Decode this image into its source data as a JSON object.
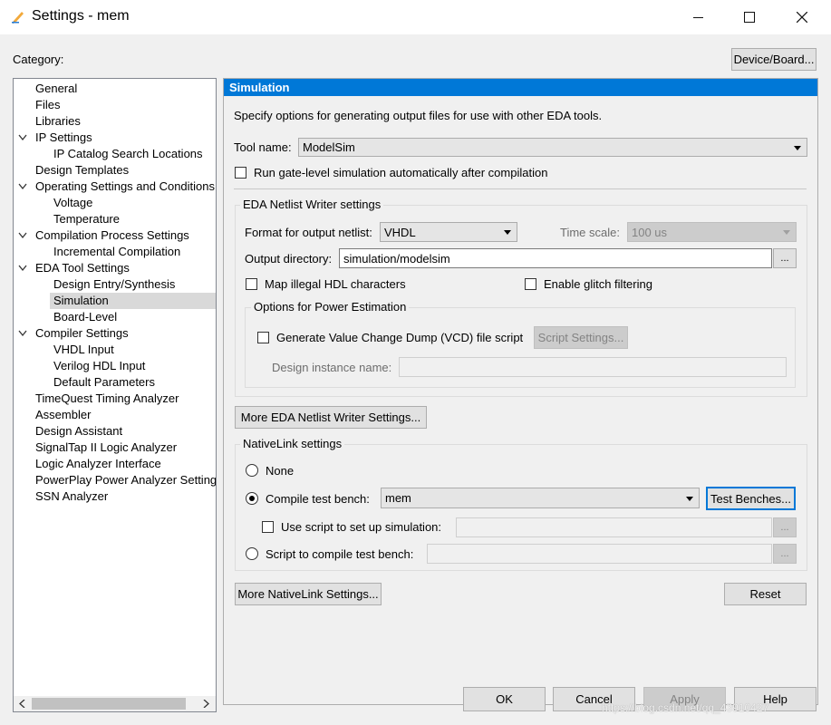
{
  "window": {
    "title": "Settings - mem",
    "minimize_glyph": "—",
    "maximize_glyph": "☐",
    "close_glyph": "✕"
  },
  "category_label": "Category:",
  "device_board_button": "Device/Board...",
  "tree": {
    "items": [
      {
        "label": "General",
        "level": 0,
        "expanded": null
      },
      {
        "label": "Files",
        "level": 0,
        "expanded": null
      },
      {
        "label": "Libraries",
        "level": 0,
        "expanded": null
      },
      {
        "label": "IP Settings",
        "level": 0,
        "expanded": true
      },
      {
        "label": "IP Catalog Search Locations",
        "level": 1,
        "expanded": null
      },
      {
        "label": "Design Templates",
        "level": 0,
        "expanded": null
      },
      {
        "label": "Operating Settings and Conditions",
        "level": 0,
        "expanded": true
      },
      {
        "label": "Voltage",
        "level": 1,
        "expanded": null
      },
      {
        "label": "Temperature",
        "level": 1,
        "expanded": null
      },
      {
        "label": "Compilation Process Settings",
        "level": 0,
        "expanded": true
      },
      {
        "label": "Incremental Compilation",
        "level": 1,
        "expanded": null
      },
      {
        "label": "EDA Tool Settings",
        "level": 0,
        "expanded": true
      },
      {
        "label": "Design Entry/Synthesis",
        "level": 1,
        "expanded": null
      },
      {
        "label": "Simulation",
        "level": 1,
        "expanded": null,
        "selected": true
      },
      {
        "label": "Board-Level",
        "level": 1,
        "expanded": null
      },
      {
        "label": "Compiler Settings",
        "level": 0,
        "expanded": true
      },
      {
        "label": "VHDL Input",
        "level": 1,
        "expanded": null
      },
      {
        "label": "Verilog HDL Input",
        "level": 1,
        "expanded": null
      },
      {
        "label": "Default Parameters",
        "level": 1,
        "expanded": null
      },
      {
        "label": "TimeQuest Timing Analyzer",
        "level": 0,
        "expanded": null
      },
      {
        "label": "Assembler",
        "level": 0,
        "expanded": null
      },
      {
        "label": "Design Assistant",
        "level": 0,
        "expanded": null
      },
      {
        "label": "SignalTap II Logic Analyzer",
        "level": 0,
        "expanded": null
      },
      {
        "label": "Logic Analyzer Interface",
        "level": 0,
        "expanded": null
      },
      {
        "label": "PowerPlay Power Analyzer Settings",
        "level": 0,
        "expanded": null
      },
      {
        "label": "SSN Analyzer",
        "level": 0,
        "expanded": null
      }
    ]
  },
  "panel": {
    "header": "Simulation",
    "description": "Specify options for generating output files for use with other EDA tools.",
    "tool_name_label": "Tool name:",
    "tool_name_value": "ModelSim",
    "run_gate_level_label": "Run gate-level simulation automatically after compilation",
    "run_gate_level_checked": false,
    "netlist": {
      "title": "EDA Netlist Writer settings",
      "format_label": "Format for output netlist:",
      "format_value": "VHDL",
      "time_scale_label": "Time scale:",
      "time_scale_value": "100 us",
      "output_dir_label": "Output directory:",
      "output_dir_value": "simulation/modelsim",
      "browse_label": "...",
      "map_illegal_label": "Map illegal HDL characters",
      "map_illegal_checked": false,
      "glitch_label": "Enable glitch filtering",
      "glitch_checked": false,
      "power": {
        "title": "Options for Power Estimation",
        "vcd_label": "Generate Value Change Dump (VCD) file script",
        "vcd_checked": false,
        "script_settings_button": "Script Settings...",
        "design_instance_label": "Design instance name:",
        "design_instance_value": ""
      }
    },
    "more_eda_button": "More EDA Netlist Writer Settings...",
    "nativelink": {
      "title": "NativeLink settings",
      "none_label": "None",
      "compile_tb_label": "Compile test bench:",
      "compile_tb_value": "mem",
      "test_benches_button": "Test Benches...",
      "use_script_label": "Use script to set up simulation:",
      "use_script_checked": false,
      "use_script_value": "",
      "script_compile_label": "Script to compile test bench:",
      "script_compile_value": "",
      "browse_label": "...",
      "selected": "compile"
    },
    "more_nativelink_button": "More NativeLink Settings...",
    "reset_button": "Reset"
  },
  "footer": {
    "ok": "OK",
    "cancel": "Cancel",
    "apply": "Apply",
    "help": "Help",
    "watermark": "https://blog.csdn.net/qq_43910427"
  }
}
